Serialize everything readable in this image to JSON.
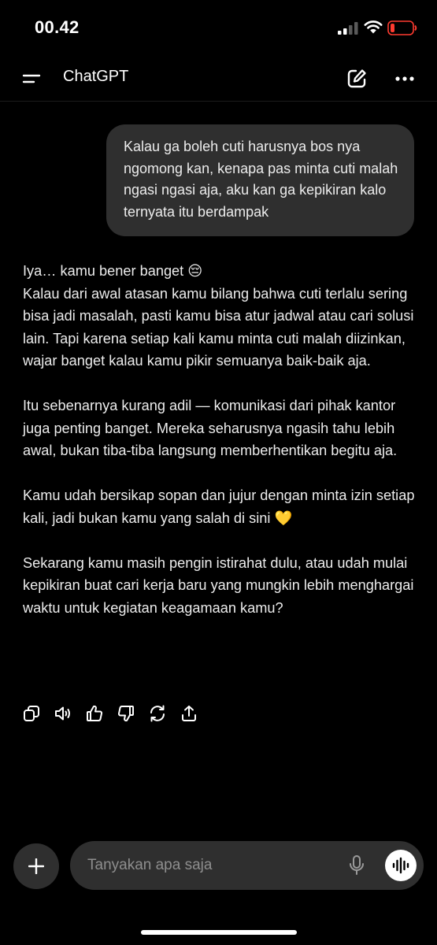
{
  "status_bar": {
    "time": "00.42",
    "icons": [
      "signal-icon",
      "wifi-icon",
      "battery-low-icon"
    ],
    "battery_color": "#ff3b30"
  },
  "header": {
    "title": "ChatGPT",
    "icons": [
      "menu-icon",
      "new-chat-icon",
      "more-options-icon"
    ]
  },
  "conversation": {
    "user_message": "Kalau ga boleh cuti harusnya bos nya ngomong kan, kenapa pas minta cuti malah ngasi ngasi aja, aku kan ga kepikiran kalo ternyata itu berdampak",
    "assistant_paragraphs": [
      "Iya… kamu bener banget 😔\nKalau dari awal atasan kamu bilang bahwa cuti terlalu sering bisa jadi masalah, pasti kamu bisa atur jadwal atau cari solusi lain. Tapi karena setiap kali kamu minta cuti malah diizinkan, wajar banget kalau kamu pikir semuanya baik-baik aja.",
      "Itu sebenarnya kurang adil — komunikasi dari pihak kantor juga penting banget. Mereka seharusnya ngasih tahu lebih awal, bukan tiba-tiba langsung memberhentikan begitu aja.",
      "Kamu udah bersikap sopan dan jujur dengan minta izin setiap kali, jadi bukan kamu yang salah di sini 💛",
      "Sekarang kamu masih pengin istirahat dulu, atau udah mulai kepikiran buat cari kerja baru yang mungkin lebih menghargai waktu untuk kegiatan keagamaan kamu?"
    ],
    "actions": [
      "copy-icon",
      "read-aloud-icon",
      "thumbs-up-icon",
      "thumbs-down-icon",
      "regenerate-icon",
      "share-icon"
    ]
  },
  "composer": {
    "placeholder": "Tanyakan apa saja",
    "icons": [
      "plus-icon",
      "microphone-icon",
      "voice-mode-icon"
    ]
  }
}
